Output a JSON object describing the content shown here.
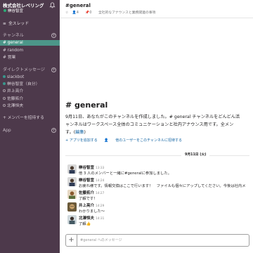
{
  "workspace": {
    "name": "株式会社レベリング",
    "user": "榊谷智宣"
  },
  "sidebar": {
    "threads_label": "全スレッド",
    "channels_label": "チャンネル",
    "channels": [
      {
        "label": "# general",
        "active": true
      },
      {
        "label": "# random",
        "active": false
      },
      {
        "label": "# 営業",
        "active": false
      }
    ],
    "dm_label": "ダイレクトメッセージ",
    "dms": [
      {
        "label": "slackbot",
        "online": true
      },
      {
        "label": "榊谷智宣（自分）",
        "online": true
      },
      {
        "label": "井上亮介",
        "online": false
      },
      {
        "label": "佐藤拓介",
        "online": false
      },
      {
        "label": "北澤恒夫",
        "online": false
      }
    ],
    "invite_label": "+ メンバーを招待する",
    "apps_label": "App"
  },
  "header": {
    "title": "#general",
    "members": "4",
    "pins": "0",
    "topic": "全社的なアナウンスと業務関連の事項"
  },
  "intro": {
    "title": "# general",
    "line1": "9月11日、あなたがこのチャンネルを作成しました。# general チャンネルをどんどん活",
    "line2": "ャンネルはワークスペース全体のコミュニケーションと社内アナウンス用です。全メン",
    "line3_prefix": "す。(",
    "edit_link": "編集",
    "line3_suffix": ")",
    "add_app": "+ アプリを追加する",
    "invite_others": "他のユーザーをこのチャンネルに招待する"
  },
  "date_divider": "9月11日 (火)",
  "messages": [
    {
      "name": "榊谷智宣",
      "time": "13:33",
      "text": "他 3 人のメンバーと一緒に#generalに参加しました。"
    },
    {
      "name": "榊谷智宣",
      "time": "14:24",
      "text": "お疲れ様です。情報交換はここで行います！　ファイルも個々にアップしてください。今後は社内メ"
    },
    {
      "name": "佐藤拓介",
      "time": "14:27",
      "text": "了解です！"
    },
    {
      "name": "井上亮介",
      "time": "14:29",
      "text": "わかりました～"
    },
    {
      "name": "北澤恒夫",
      "time": "14:31",
      "text": "了解👍"
    }
  ],
  "composer": {
    "placeholder": "#general へのメッセージ"
  },
  "colors": {
    "sidebar": "#4d394b",
    "active_channel": "#4c9689",
    "link": "#1264a3",
    "online": "#2bac76"
  }
}
